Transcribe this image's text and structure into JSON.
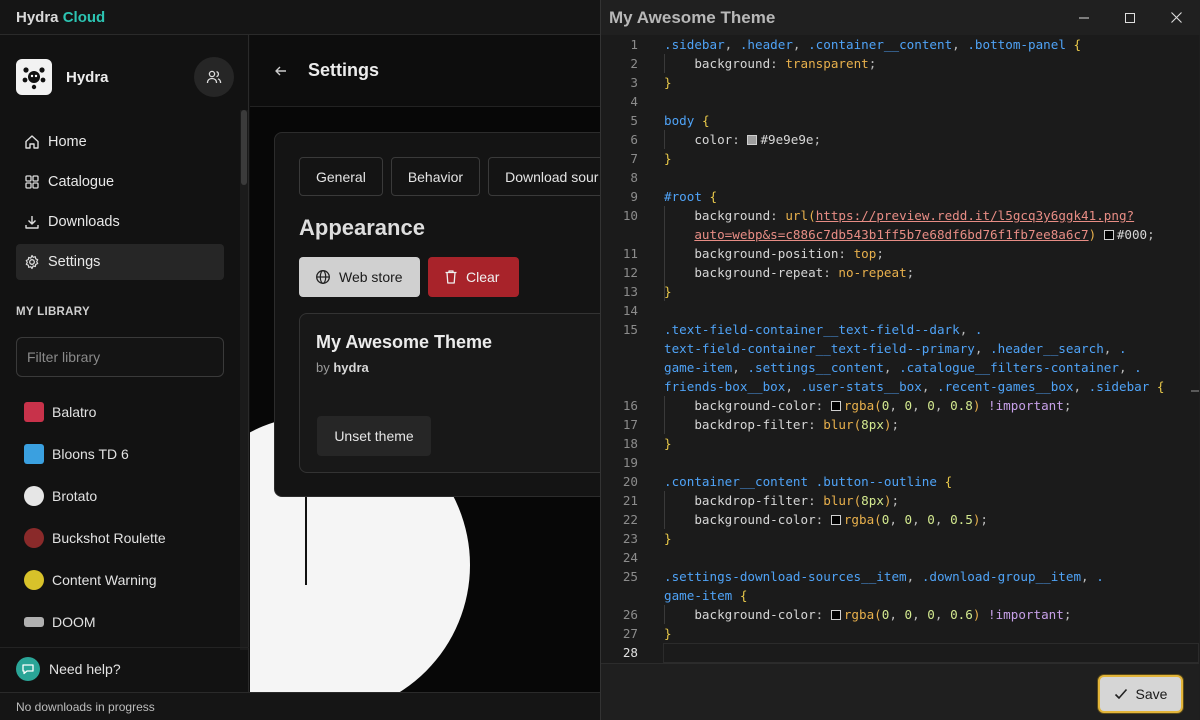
{
  "app": {
    "brand": "Hydra",
    "brand_suffix": "Cloud",
    "profile_name": "Hydra",
    "nav": [
      {
        "label": "Home",
        "icon": "home-icon"
      },
      {
        "label": "Catalogue",
        "icon": "grid-icon"
      },
      {
        "label": "Downloads",
        "icon": "download-icon"
      },
      {
        "label": "Settings",
        "icon": "gear-icon",
        "active": true
      }
    ],
    "library": {
      "title": "MY LIBRARY",
      "filter_placeholder": "Filter library",
      "games": [
        {
          "name": "Balatro",
          "color": "#c8324a"
        },
        {
          "name": "Bloons TD 6",
          "color": "#3aa0e0"
        },
        {
          "name": "Brotato",
          "color": "#e6e6e6"
        },
        {
          "name": "Buckshot Roulette",
          "color": "#8a2a2a"
        },
        {
          "name": "Content Warning",
          "color": "#d8c22a"
        },
        {
          "name": "DOOM",
          "color": "#b0b0b0"
        }
      ]
    },
    "help_label": "Need help?",
    "status": "No downloads in progress",
    "header_title": "Settings",
    "settings": {
      "tabs": [
        "General",
        "Behavior",
        "Download sour"
      ],
      "section_title": "Appearance",
      "web_store_label": "Web store",
      "clear_label": "Clear",
      "theme": {
        "name": "My Awesome Theme",
        "author_prefix": "by",
        "author": "hydra",
        "unset_label": "Unset theme"
      }
    }
  },
  "editor": {
    "title": "My Awesome Theme",
    "save_label": "Save",
    "line_numbers": [
      "1",
      "2",
      "3",
      "4",
      "5",
      "6",
      "7",
      "8",
      "9",
      "10",
      "11",
      "12",
      "13",
      "14",
      "15",
      "16",
      "17",
      "18",
      "19",
      "20",
      "21",
      "22",
      "23",
      "24",
      "25",
      "26",
      "27",
      "28"
    ],
    "current_line": "28"
  },
  "colors": {
    "accent": "#2cc4b2",
    "danger": "#a8232a",
    "save_border": "#e3b53a"
  }
}
